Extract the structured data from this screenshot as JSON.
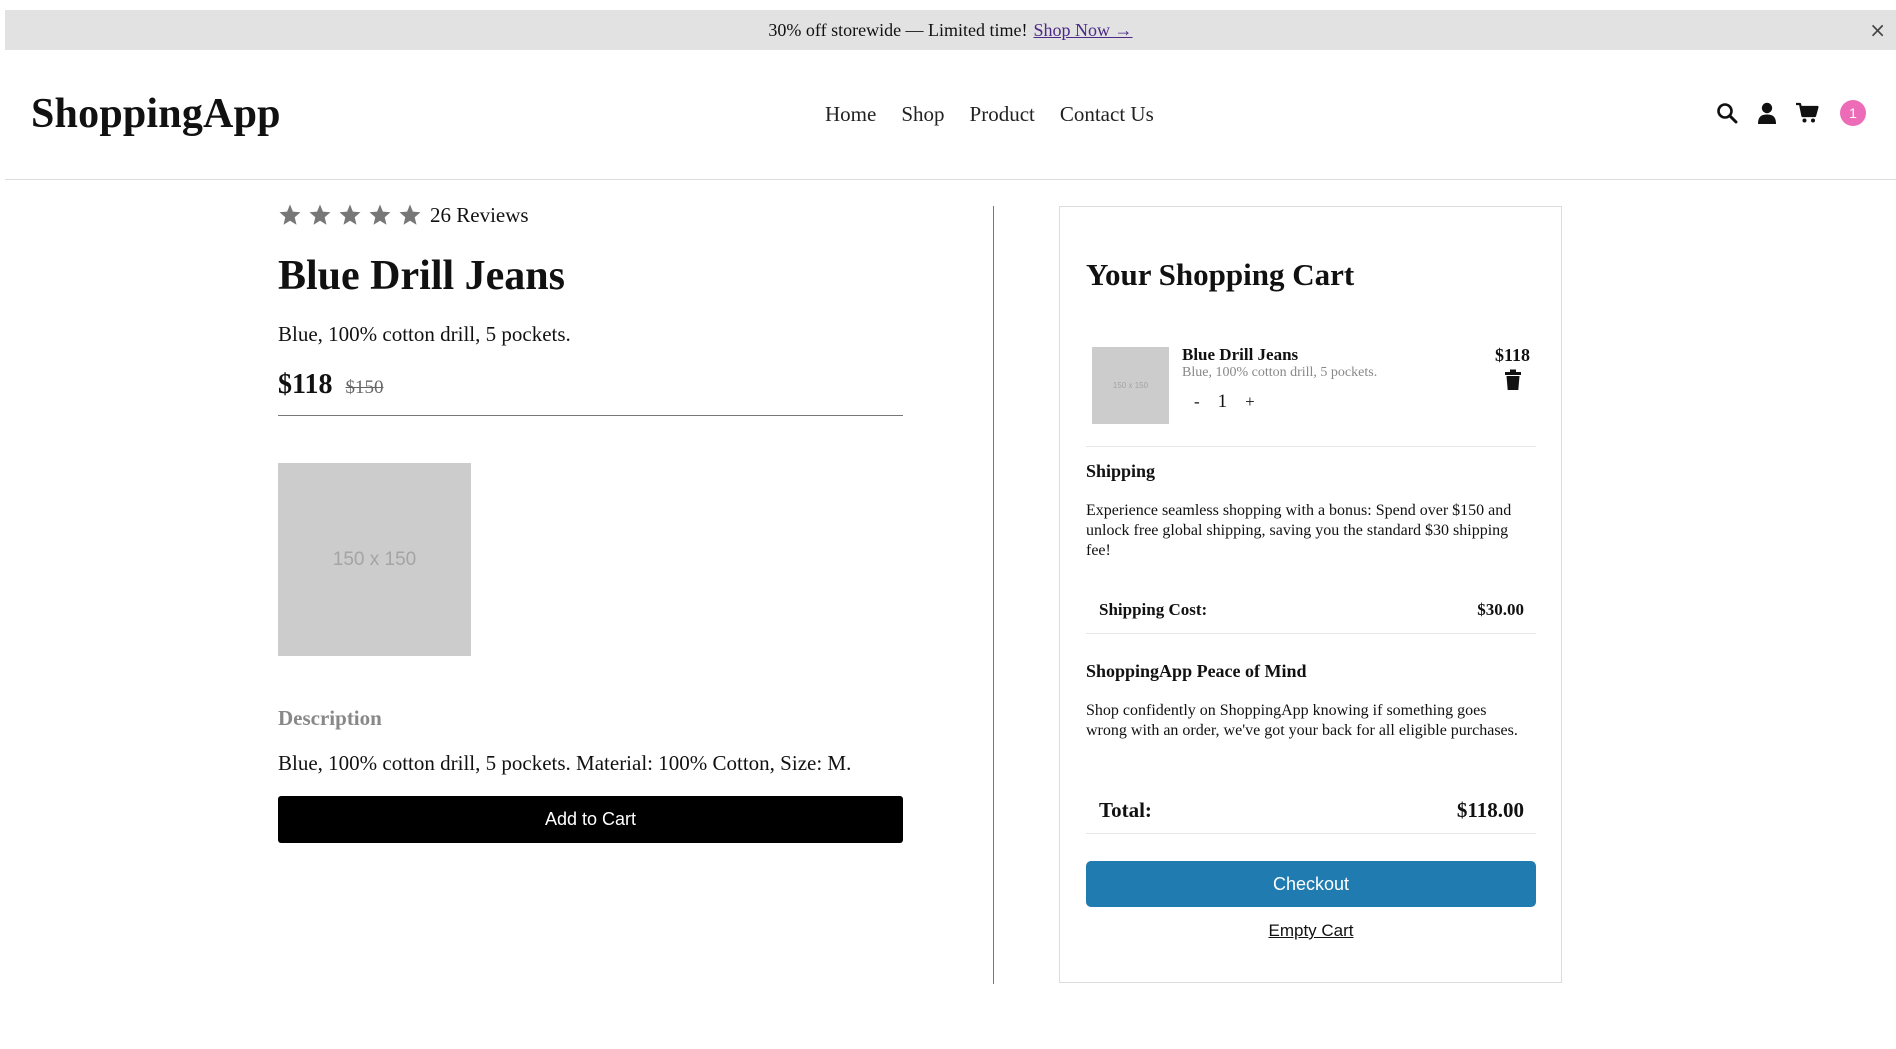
{
  "banner": {
    "text": "30% off storewide — Limited time!",
    "link": "Shop Now →",
    "close": "×"
  },
  "header": {
    "logo": "ShoppingApp",
    "nav": [
      "Home",
      "Shop",
      "Product",
      "Contact Us"
    ],
    "icons": [
      "search-icon",
      "user-icon",
      "cart-icon"
    ],
    "cart_count": "1",
    "badge_color": "#ec6cb8"
  },
  "product": {
    "rating_stars": 5,
    "reviews": "26 Reviews",
    "title": "Blue Drill Jeans",
    "short_desc": "Blue, 100% cotton drill, 5 pockets.",
    "price": "$118",
    "old_price": "$150",
    "image_placeholder": "150 x 150",
    "description_heading": "Description",
    "description": "Blue, 100% cotton drill, 5 pockets. Material: 100% Cotton, Size: M.",
    "add_to_cart": "Add to Cart"
  },
  "cart": {
    "title": "Your Shopping Cart",
    "item": {
      "thumb": "150 x 150",
      "name": "Blue Drill Jeans",
      "desc": "Blue, 100% cotton drill, 5 pockets.",
      "qty_minus": "-",
      "qty": "1",
      "qty_plus": "+",
      "price": "$118"
    },
    "shipping_heading": "Shipping",
    "shipping_text": "Experience seamless shopping with a bonus: Spend over $150 and unlock free global shipping, saving you the standard $30 shipping fee!",
    "shipping_cost_label": "Shipping Cost:",
    "shipping_cost": "$30.00",
    "peace_heading": "ShoppingApp Peace of Mind",
    "peace_text": "Shop confidently on ShoppingApp knowing if something goes wrong with an order, we've got your back for all eligible purchases.",
    "total_label": "Total:",
    "total": "$118.00",
    "checkout": "Checkout",
    "empty": "Empty Cart",
    "checkout_color": "#1f7bb0"
  }
}
